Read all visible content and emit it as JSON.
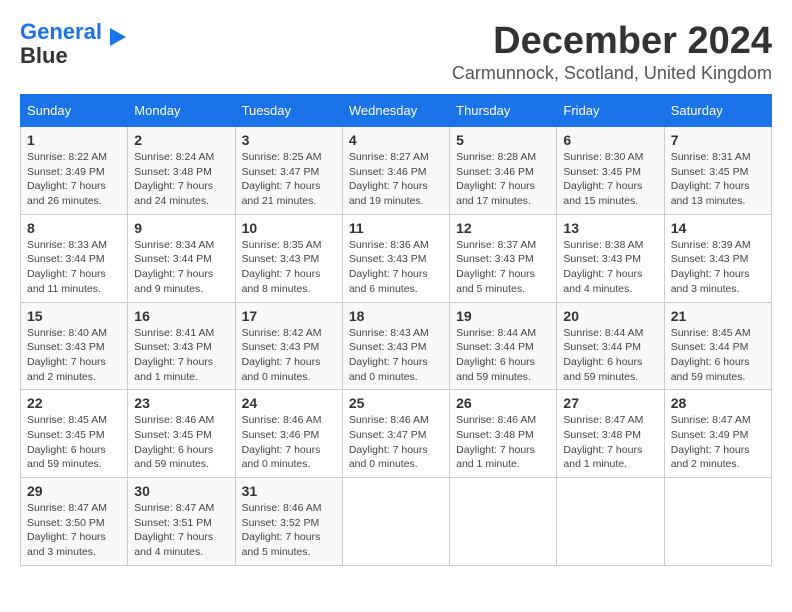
{
  "logo": {
    "line1": "General",
    "line2": "Blue"
  },
  "header": {
    "month": "December 2024",
    "location": "Carmunnock, Scotland, United Kingdom"
  },
  "weekdays": [
    "Sunday",
    "Monday",
    "Tuesday",
    "Wednesday",
    "Thursday",
    "Friday",
    "Saturday"
  ],
  "weeks": [
    [
      {
        "day": 1,
        "sunrise": "8:22 AM",
        "sunset": "3:49 PM",
        "daylight": "7 hours and 26 minutes."
      },
      {
        "day": 2,
        "sunrise": "8:24 AM",
        "sunset": "3:48 PM",
        "daylight": "7 hours and 24 minutes."
      },
      {
        "day": 3,
        "sunrise": "8:25 AM",
        "sunset": "3:47 PM",
        "daylight": "7 hours and 21 minutes."
      },
      {
        "day": 4,
        "sunrise": "8:27 AM",
        "sunset": "3:46 PM",
        "daylight": "7 hours and 19 minutes."
      },
      {
        "day": 5,
        "sunrise": "8:28 AM",
        "sunset": "3:46 PM",
        "daylight": "7 hours and 17 minutes."
      },
      {
        "day": 6,
        "sunrise": "8:30 AM",
        "sunset": "3:45 PM",
        "daylight": "7 hours and 15 minutes."
      },
      {
        "day": 7,
        "sunrise": "8:31 AM",
        "sunset": "3:45 PM",
        "daylight": "7 hours and 13 minutes."
      }
    ],
    [
      {
        "day": 8,
        "sunrise": "8:33 AM",
        "sunset": "3:44 PM",
        "daylight": "7 hours and 11 minutes."
      },
      {
        "day": 9,
        "sunrise": "8:34 AM",
        "sunset": "3:44 PM",
        "daylight": "7 hours and 9 minutes."
      },
      {
        "day": 10,
        "sunrise": "8:35 AM",
        "sunset": "3:43 PM",
        "daylight": "7 hours and 8 minutes."
      },
      {
        "day": 11,
        "sunrise": "8:36 AM",
        "sunset": "3:43 PM",
        "daylight": "7 hours and 6 minutes."
      },
      {
        "day": 12,
        "sunrise": "8:37 AM",
        "sunset": "3:43 PM",
        "daylight": "7 hours and 5 minutes."
      },
      {
        "day": 13,
        "sunrise": "8:38 AM",
        "sunset": "3:43 PM",
        "daylight": "7 hours and 4 minutes."
      },
      {
        "day": 14,
        "sunrise": "8:39 AM",
        "sunset": "3:43 PM",
        "daylight": "7 hours and 3 minutes."
      }
    ],
    [
      {
        "day": 15,
        "sunrise": "8:40 AM",
        "sunset": "3:43 PM",
        "daylight": "7 hours and 2 minutes."
      },
      {
        "day": 16,
        "sunrise": "8:41 AM",
        "sunset": "3:43 PM",
        "daylight": "7 hours and 1 minute."
      },
      {
        "day": 17,
        "sunrise": "8:42 AM",
        "sunset": "3:43 PM",
        "daylight": "7 hours and 0 minutes."
      },
      {
        "day": 18,
        "sunrise": "8:43 AM",
        "sunset": "3:43 PM",
        "daylight": "7 hours and 0 minutes."
      },
      {
        "day": 19,
        "sunrise": "8:44 AM",
        "sunset": "3:44 PM",
        "daylight": "6 hours and 59 minutes."
      },
      {
        "day": 20,
        "sunrise": "8:44 AM",
        "sunset": "3:44 PM",
        "daylight": "6 hours and 59 minutes."
      },
      {
        "day": 21,
        "sunrise": "8:45 AM",
        "sunset": "3:44 PM",
        "daylight": "6 hours and 59 minutes."
      }
    ],
    [
      {
        "day": 22,
        "sunrise": "8:45 AM",
        "sunset": "3:45 PM",
        "daylight": "6 hours and 59 minutes."
      },
      {
        "day": 23,
        "sunrise": "8:46 AM",
        "sunset": "3:45 PM",
        "daylight": "6 hours and 59 minutes."
      },
      {
        "day": 24,
        "sunrise": "8:46 AM",
        "sunset": "3:46 PM",
        "daylight": "7 hours and 0 minutes."
      },
      {
        "day": 25,
        "sunrise": "8:46 AM",
        "sunset": "3:47 PM",
        "daylight": "7 hours and 0 minutes."
      },
      {
        "day": 26,
        "sunrise": "8:46 AM",
        "sunset": "3:48 PM",
        "daylight": "7 hours and 1 minute."
      },
      {
        "day": 27,
        "sunrise": "8:47 AM",
        "sunset": "3:48 PM",
        "daylight": "7 hours and 1 minute."
      },
      {
        "day": 28,
        "sunrise": "8:47 AM",
        "sunset": "3:49 PM",
        "daylight": "7 hours and 2 minutes."
      }
    ],
    [
      {
        "day": 29,
        "sunrise": "8:47 AM",
        "sunset": "3:50 PM",
        "daylight": "7 hours and 3 minutes."
      },
      {
        "day": 30,
        "sunrise": "8:47 AM",
        "sunset": "3:51 PM",
        "daylight": "7 hours and 4 minutes."
      },
      {
        "day": 31,
        "sunrise": "8:46 AM",
        "sunset": "3:52 PM",
        "daylight": "7 hours and 5 minutes."
      },
      null,
      null,
      null,
      null
    ]
  ]
}
